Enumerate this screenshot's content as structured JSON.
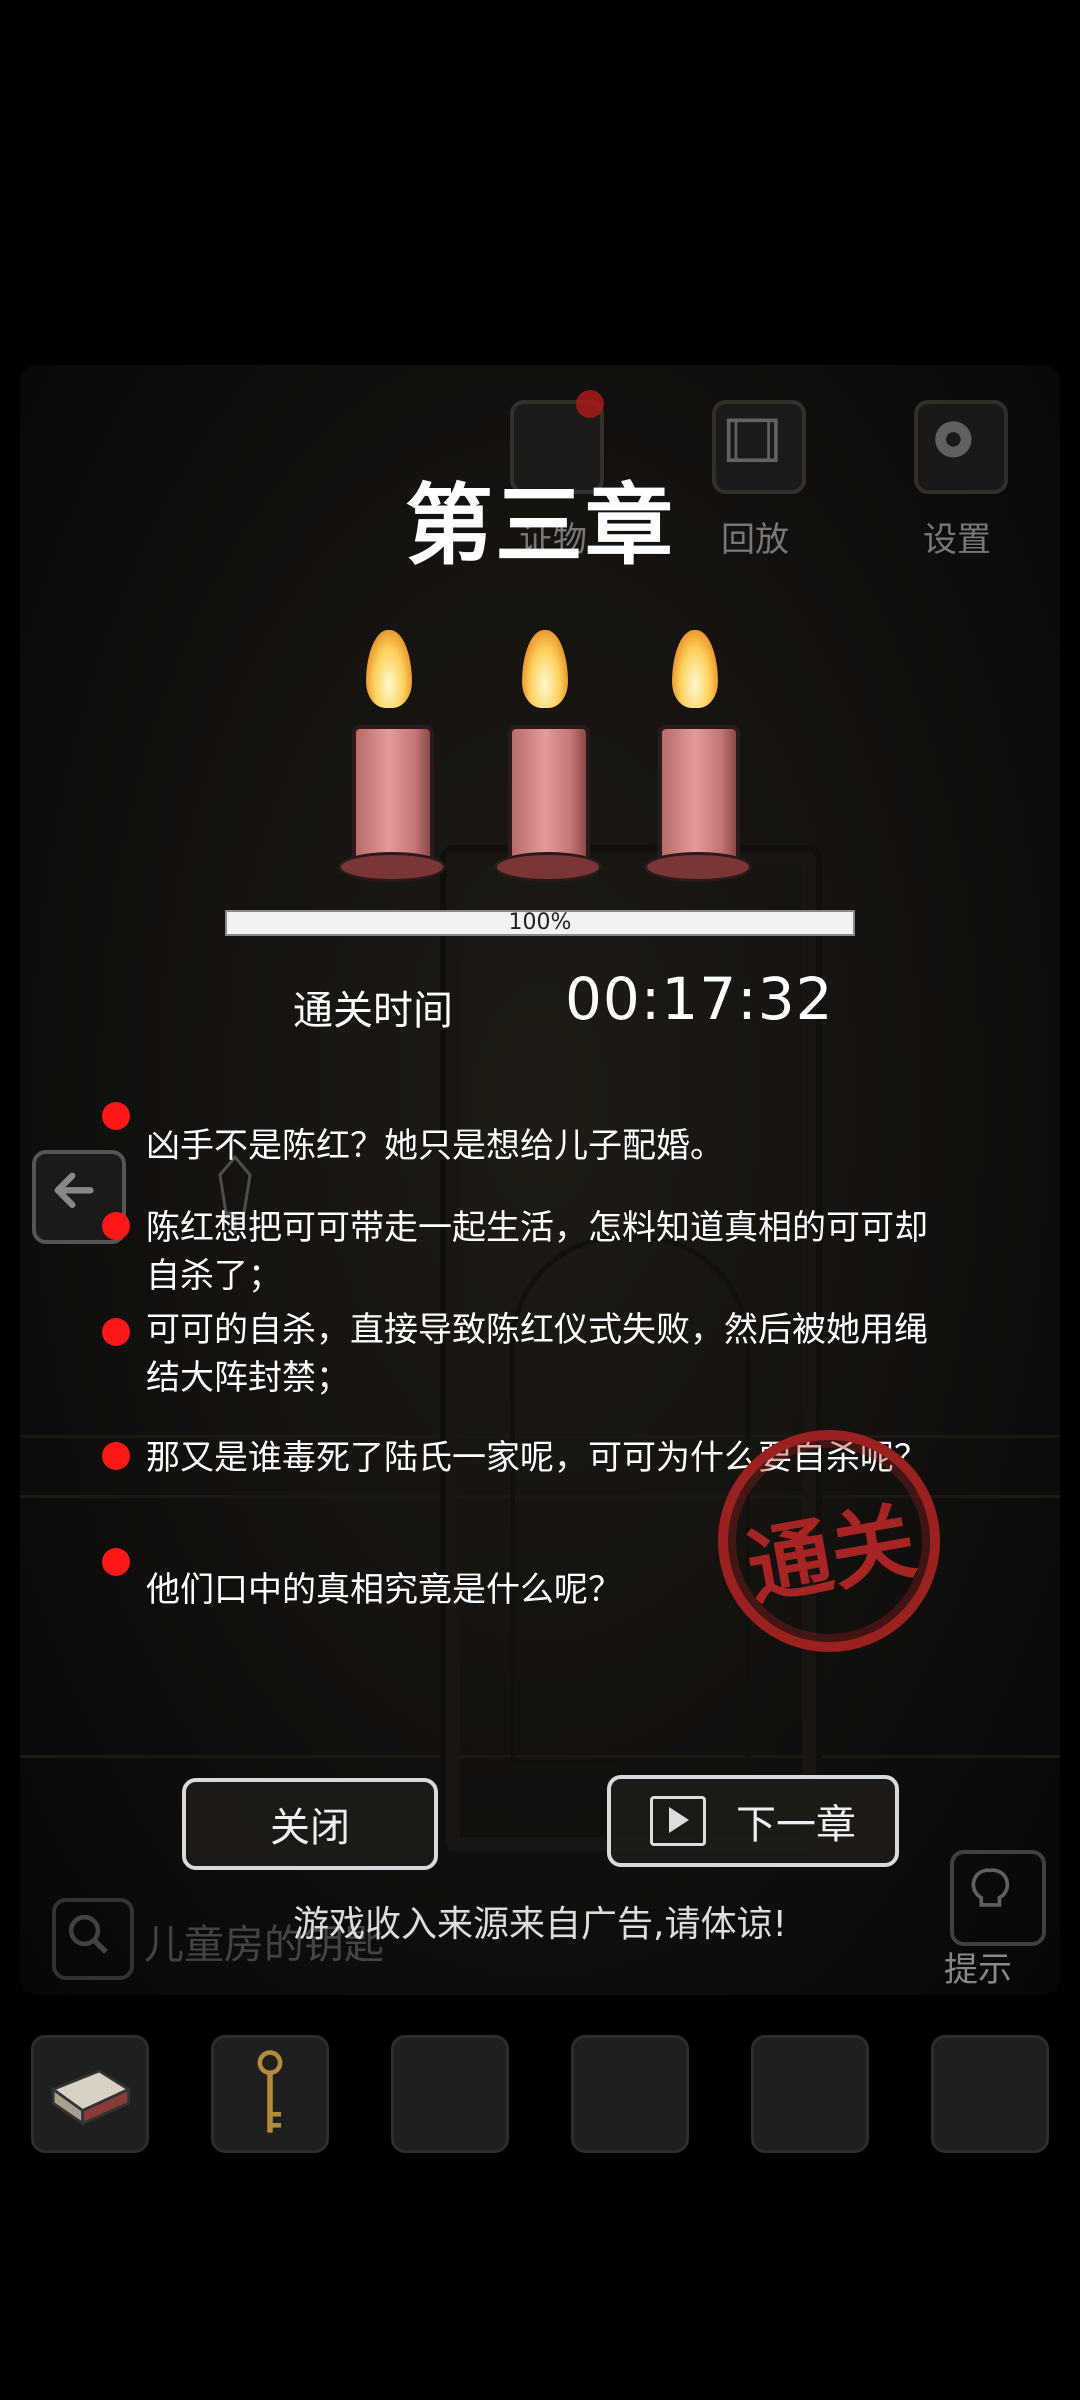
{
  "top_bar": {
    "evidence_label": "证物",
    "replay_label": "回放",
    "settings_label": "设置"
  },
  "chapter": {
    "title": "第三章",
    "progress_percent": 100,
    "progress_text": "100%",
    "time_label": "通关时间",
    "time_value": "00:17:32"
  },
  "notes": [
    {
      "text": "凶手不是陈红？她只是想给儿子配婚。"
    },
    {
      "text": "陈红想把可可带走一起生活，怎料知道真相的可可却自杀了；"
    },
    {
      "text": "可可的自杀，直接导致陈红仪式失败，然后被她用绳结大阵封禁；"
    },
    {
      "text": "那又是谁毒死了陆氏一家呢，可可为什么要自杀呢？"
    },
    {
      "text": "他们口中的真相究竟是什么呢？"
    }
  ],
  "stamp_text": "通关",
  "buttons": {
    "close_label": "关闭",
    "next_label": "下一章"
  },
  "ad_note": "游戏收入来源来自广告,请体谅!",
  "search_text": "儿童房的钥匙",
  "hint_label": "提示",
  "inventory": [
    "matchbox",
    "key",
    "",
    "",
    "",
    ""
  ],
  "colors": {
    "note_dot": "#ff1616",
    "stamp": "#a72424",
    "candle": "#e59a9a"
  }
}
